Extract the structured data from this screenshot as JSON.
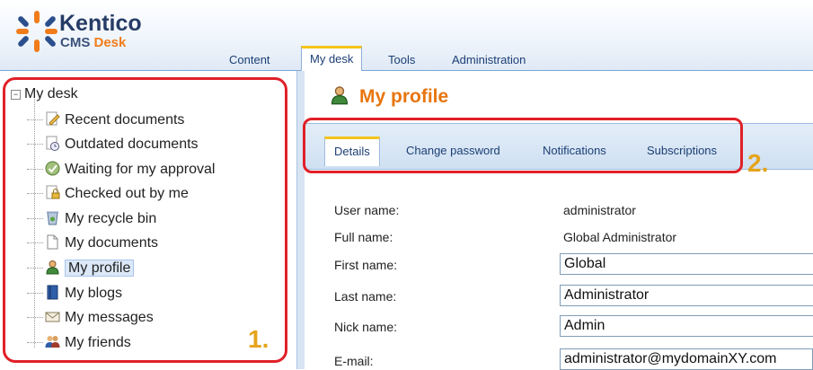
{
  "app": {
    "brand": "Kentico",
    "product_prefix": "CMS ",
    "product_suffix": "Desk"
  },
  "main_tabs": [
    {
      "label": "Content"
    },
    {
      "label": "My desk"
    },
    {
      "label": "Tools"
    },
    {
      "label": "Administration"
    }
  ],
  "tree": {
    "root": "My desk",
    "items": [
      {
        "label": "Recent documents",
        "icon": "pencil-document-icon"
      },
      {
        "label": "Outdated documents",
        "icon": "clock-document-icon"
      },
      {
        "label": "Waiting for my approval",
        "icon": "check-approval-icon"
      },
      {
        "label": "Checked out by me",
        "icon": "lock-document-icon"
      },
      {
        "label": "My recycle bin",
        "icon": "recycle-bin-icon"
      },
      {
        "label": "My documents",
        "icon": "document-icon"
      },
      {
        "label": "My profile",
        "icon": "user-icon"
      },
      {
        "label": "My blogs",
        "icon": "blog-book-icon"
      },
      {
        "label": "My messages",
        "icon": "envelope-icon"
      },
      {
        "label": "My friends",
        "icon": "friends-icon"
      }
    ]
  },
  "annotations": {
    "label1": "1.",
    "label2": "2."
  },
  "page": {
    "title": "My profile"
  },
  "sub_tabs": [
    {
      "label": "Details"
    },
    {
      "label": "Change password"
    },
    {
      "label": "Notifications"
    },
    {
      "label": "Subscriptions"
    }
  ],
  "form": {
    "user_name_label": "User name:",
    "user_name_value": "administrator",
    "full_name_label": "Full name:",
    "full_name_value": "Global Administrator",
    "first_name_label": "First name:",
    "first_name_value": "Global",
    "last_name_label": "Last name:",
    "last_name_value": "Administrator",
    "nick_name_label": "Nick name:",
    "nick_name_value": "Admin",
    "email_label": "E-mail:",
    "email_value": "administrator@mydomainXY.com"
  },
  "colors": {
    "accent_orange": "#e8750f",
    "highlight_red": "#e02028",
    "annotation_gold": "#e6a41b",
    "tab_underline": "#f4c51b"
  }
}
